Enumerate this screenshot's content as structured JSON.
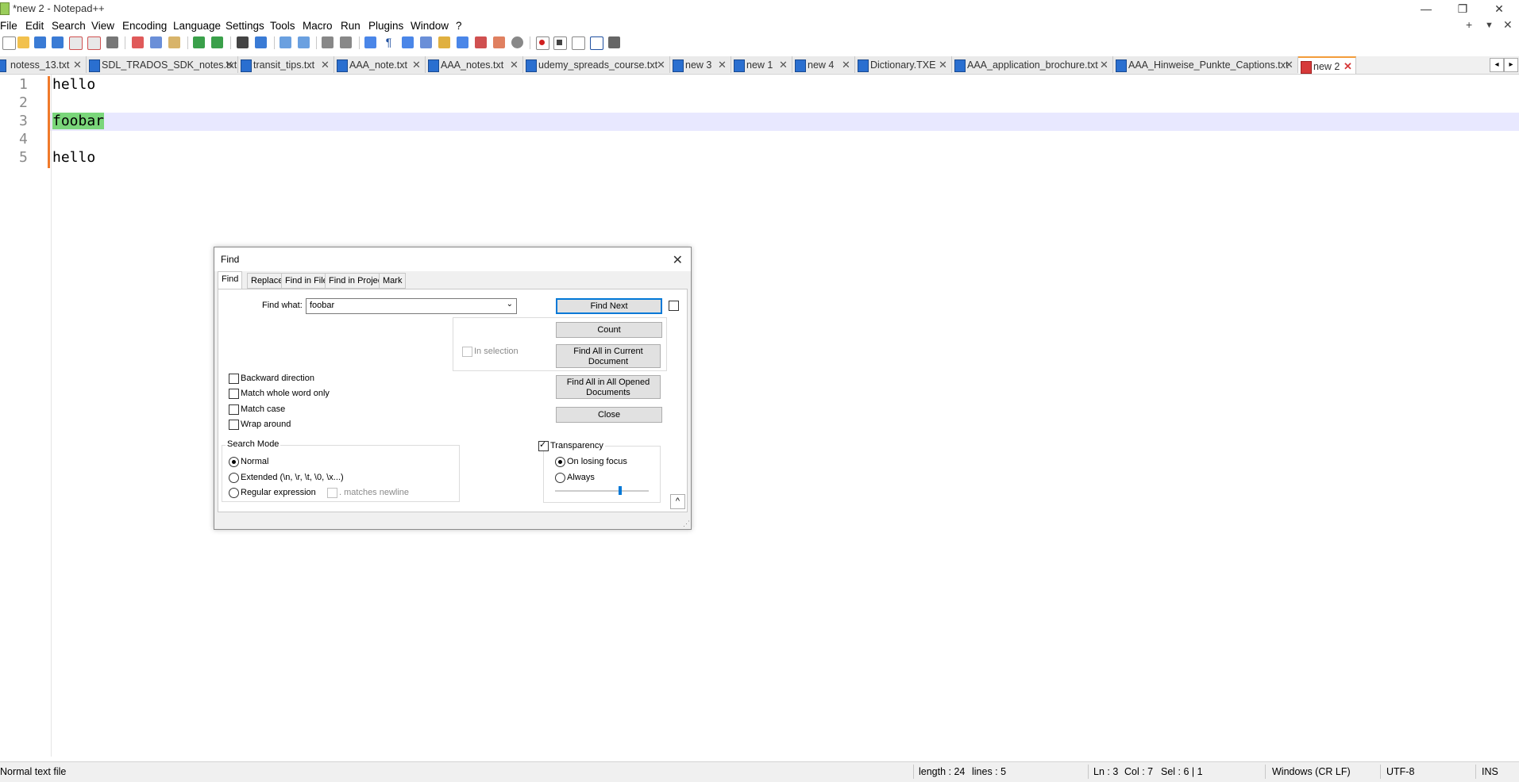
{
  "window": {
    "title": "*new 2 - Notepad++",
    "minimize": "—",
    "restore": "❐",
    "close": "✕"
  },
  "menu": {
    "items": [
      "File",
      "Edit",
      "Search",
      "View",
      "Encoding",
      "Language",
      "Settings",
      "Tools",
      "Macro",
      "Run",
      "Plugins",
      "Window",
      "?"
    ],
    "right_plus": "+",
    "right_down": "▼",
    "right_close": "✕"
  },
  "toolbar": {
    "icons": [
      "new-file-icon",
      "open-file-icon",
      "save-icon",
      "save-all-icon",
      "close-icon",
      "close-all-icon",
      "print-icon",
      "cut-icon",
      "copy-icon",
      "paste-icon",
      "undo-icon",
      "redo-icon",
      "find-icon",
      "replace-icon",
      "zoom-in-icon",
      "zoom-out-icon",
      "sync-vertical-icon",
      "sync-horizontal-icon",
      "word-wrap-icon",
      "show-all-chars-icon",
      "indent-guide-icon",
      "user-lang-icon",
      "doc-map-icon",
      "function-list-icon",
      "folder-workspace-icon",
      "monitoring-icon",
      "record-macro-icon",
      "stop-macro-icon",
      "play-macro-icon",
      "run-macro-multiple-icon",
      "save-macro-icon"
    ]
  },
  "tabs": [
    {
      "label": "notess_13.txt",
      "active": false
    },
    {
      "label": "SDL_TRADOS_SDK_notes.txt",
      "active": false
    },
    {
      "label": "transit_tips.txt",
      "active": false
    },
    {
      "label": "AAA_note.txt",
      "active": false
    },
    {
      "label": "AAA_notes.txt",
      "active": false
    },
    {
      "label": "udemy_spreads_course.txt",
      "active": false
    },
    {
      "label": "new 3",
      "active": false
    },
    {
      "label": "new 1",
      "active": false
    },
    {
      "label": "new 4",
      "active": false
    },
    {
      "label": "Dictionary.TXE",
      "active": false
    },
    {
      "label": "AAA_application_brochure.txt",
      "active": false
    },
    {
      "label": "AAA_Hinweise_Punkte_Captions.txt",
      "active": false
    },
    {
      "label": "new 2",
      "active": true
    }
  ],
  "tab_close_glyph": "✕",
  "tab_nav": {
    "left": "◂",
    "right": "▸"
  },
  "editor": {
    "lines": [
      {
        "num": "1",
        "text": "hello"
      },
      {
        "num": "2",
        "text": ""
      },
      {
        "num": "3",
        "text": "foobar"
      },
      {
        "num": "4",
        "text": ""
      },
      {
        "num": "5",
        "text": "hello"
      }
    ],
    "current_line": 3,
    "highlight_color": "#7ad67a",
    "change_bar_color": "#f07a2a"
  },
  "status": {
    "file_type": "Normal text file",
    "length": "length : 24",
    "lines": "lines : 5",
    "ln": "Ln : 3",
    "col": "Col : 7",
    "sel": "Sel : 6 | 1",
    "eol": "Windows (CR LF)",
    "encoding": "UTF-8",
    "mode": "INS"
  },
  "find_dialog": {
    "title": "Find",
    "close": "✕",
    "tabs": [
      "Find",
      "Replace",
      "Find in Files",
      "Find in Projects",
      "Mark"
    ],
    "find_what_label": "Find what:",
    "find_what_value": "foobar",
    "combo_arrow": "⌄",
    "in_selection": "In selection",
    "buttons": {
      "find_next": "Find Next",
      "count": "Count",
      "find_all_current_1": "Find All in Current",
      "find_all_current_2": "Document",
      "find_all_opened_1": "Find All in All Opened",
      "find_all_opened_2": "Documents",
      "close": "Close"
    },
    "options": {
      "backward": "Backward direction",
      "whole_word": "Match whole word only",
      "match_case": "Match case",
      "wrap_around": "Wrap around"
    },
    "search_mode": {
      "title": "Search Mode",
      "normal": "Normal",
      "extended": "Extended (\\n, \\r, \\t, \\0, \\x...)",
      "regex": "Regular expression",
      "matches_newline": ". matches newline",
      "selected": "normal"
    },
    "transparency": {
      "label": "Transparency",
      "checked": true,
      "on_losing_focus": "On losing focus",
      "always": "Always",
      "selected": "on_losing_focus",
      "slider_value": 0.7
    },
    "collapse": "^",
    "grip": "⋰"
  }
}
